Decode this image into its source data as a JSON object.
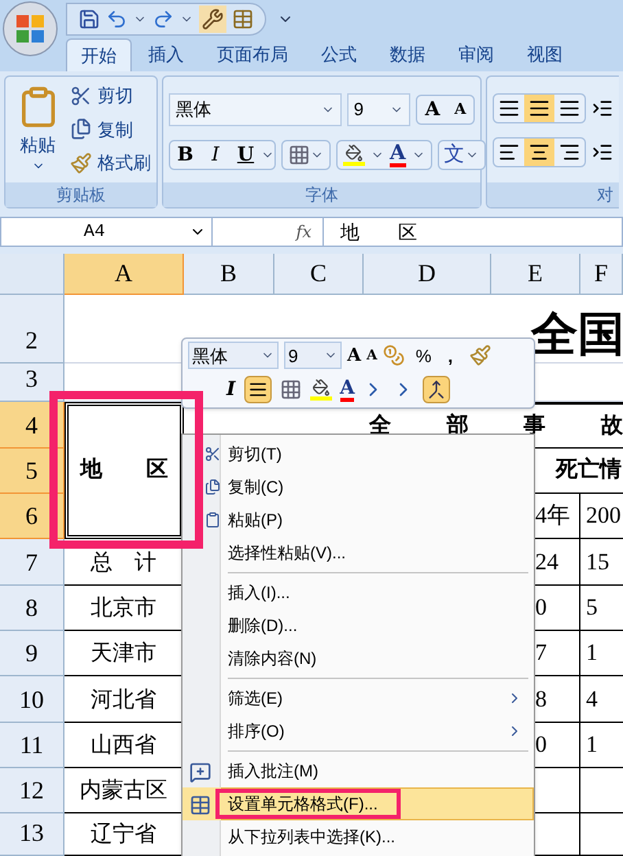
{
  "tabs": [
    {
      "label": "开始",
      "selected": true
    },
    {
      "label": "插入",
      "selected": false
    },
    {
      "label": "页面布局",
      "selected": false
    },
    {
      "label": "公式",
      "selected": false
    },
    {
      "label": "数据",
      "selected": false
    },
    {
      "label": "审阅",
      "selected": false
    },
    {
      "label": "视图",
      "selected": false
    }
  ],
  "clipboard": {
    "paste": "粘贴",
    "cut": "剪切",
    "copy": "复制",
    "format_painter": "格式刷",
    "label": "剪贴板"
  },
  "font": {
    "name": "黑体",
    "size": "9",
    "grow": "A",
    "shrink": "A",
    "bold": "B",
    "italic": "I",
    "underline": "U",
    "font_color_letter": "A",
    "phonetic": "文",
    "label": "字体"
  },
  "alignment": {
    "label": "对",
    "center_selected": true
  },
  "formula_bar": {
    "name_box": "A4",
    "fx": "fx",
    "formula": "地　　区"
  },
  "columns": [
    {
      "label": "A",
      "selected": true
    },
    {
      "label": "B",
      "selected": false
    },
    {
      "label": "C",
      "selected": false
    },
    {
      "label": "D",
      "selected": false
    },
    {
      "label": "E",
      "selected": false
    },
    {
      "label": "F",
      "selected": false
    }
  ],
  "rows": [
    {
      "header": "2",
      "selected": false,
      "title": "全国"
    },
    {
      "header": "3",
      "selected": false
    },
    {
      "header": "4",
      "selected": true,
      "region": "地　　区",
      "headings": [
        "全",
        "部",
        "事",
        "故"
      ]
    },
    {
      "header": "5",
      "selected": true,
      "subheading": "死亡情"
    },
    {
      "header": "6",
      "selected": true,
      "e": "4年",
      "f": "200"
    },
    {
      "header": "7",
      "selected": false,
      "a": "总　计",
      "e": "24",
      "f": "15"
    },
    {
      "header": "8",
      "selected": false,
      "a": "北京市",
      "e": "0",
      "f": "5"
    },
    {
      "header": "9",
      "selected": false,
      "a": "天津市",
      "e": "7",
      "f": "1"
    },
    {
      "header": "10",
      "selected": false,
      "a": "河北省",
      "e": "8",
      "f": "4"
    },
    {
      "header": "11",
      "selected": false,
      "a": "山西省",
      "e": "0",
      "f": "1"
    },
    {
      "header": "12",
      "selected": false,
      "a": "内蒙古区"
    },
    {
      "header": "13",
      "selected": false,
      "a": "辽宁省"
    }
  ],
  "mini_toolbar": {
    "font": "黑体",
    "size": "9",
    "grow": "A",
    "shrink": "A",
    "percent": "%",
    "comma": ",",
    "italic": "I",
    "font_color_letter": "A",
    "center_selected": true,
    "merge_selected": true
  },
  "menu": [
    {
      "label": "剪切(T)",
      "selected": false
    },
    {
      "label": "复制(C)",
      "selected": false
    },
    {
      "label": "粘贴(P)",
      "selected": false
    },
    {
      "label": "选择性粘贴(V)...",
      "selected": false
    },
    {
      "label": "插入(I)...",
      "selected": false,
      "divider_before": true
    },
    {
      "label": "删除(D)...",
      "selected": false
    },
    {
      "label": "清除内容(N)",
      "selected": false
    },
    {
      "label": "筛选(E)",
      "selected": false,
      "divider_before": true,
      "submenu": true
    },
    {
      "label": "排序(O)",
      "selected": false,
      "submenu": true
    },
    {
      "label": "插入批注(M)",
      "selected": false,
      "divider_before": true
    },
    {
      "label": "设置单元格格式(F)...",
      "selected": true
    },
    {
      "label": "从下拉列表中选择(K)...",
      "selected": false
    }
  ]
}
